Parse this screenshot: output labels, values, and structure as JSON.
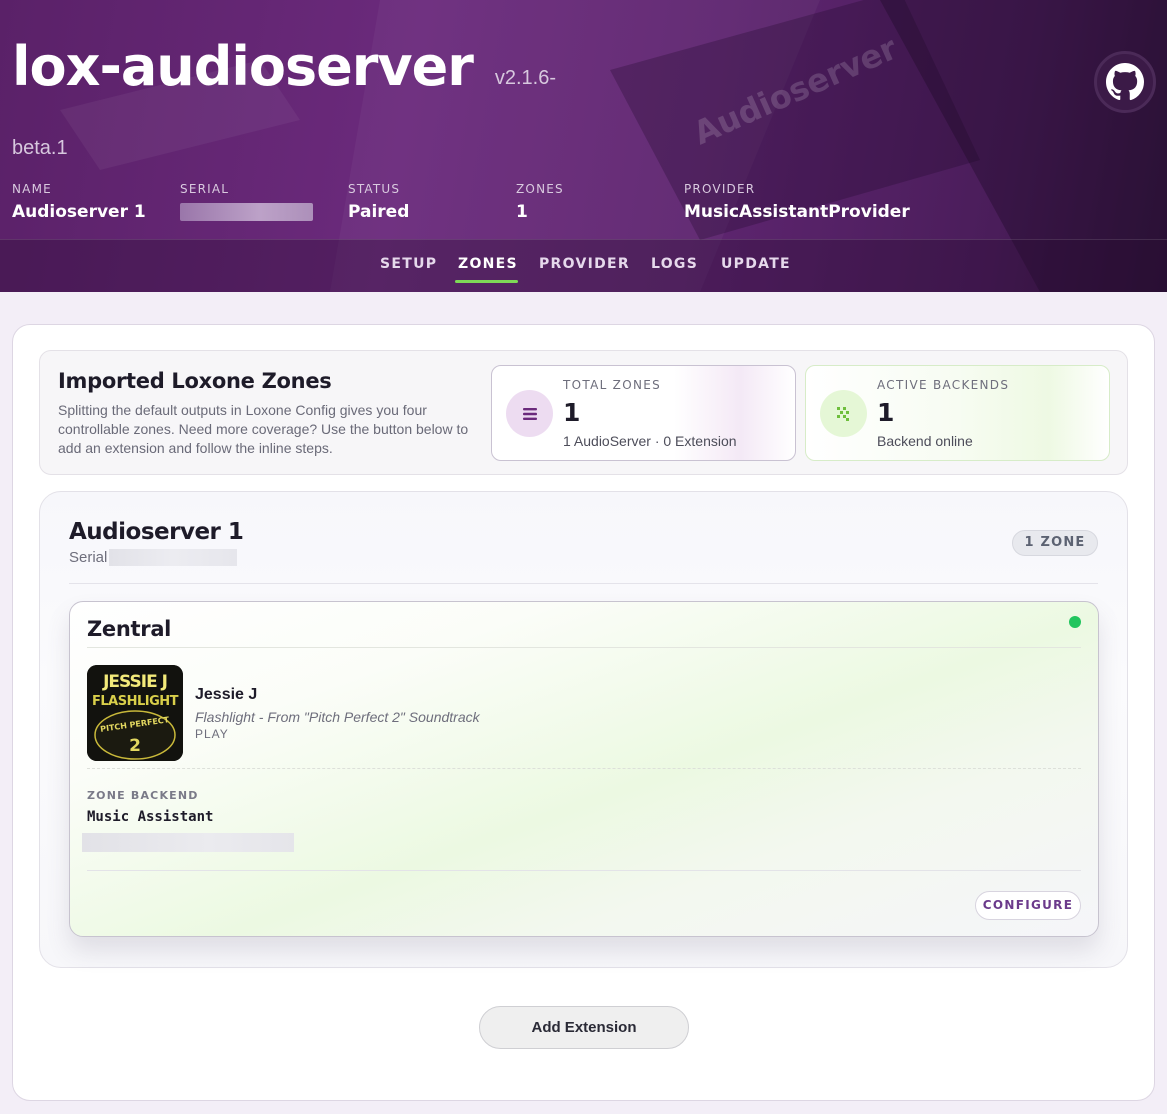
{
  "app": {
    "title": "lox-audioserver",
    "version_line1": "v2.1.6-",
    "version_line2": "beta.1"
  },
  "meta": [
    {
      "label": "NAME",
      "value": "Audioserver 1"
    },
    {
      "label": "SERIAL",
      "value": ""
    },
    {
      "label": "STATUS",
      "value": "Paired"
    },
    {
      "label": "ZONES",
      "value": "1"
    },
    {
      "label": "PROVIDER",
      "value": "MusicAssistantProvider"
    }
  ],
  "nav": {
    "items": [
      "SETUP",
      "ZONES",
      "PROVIDER",
      "LOGS",
      "UPDATE"
    ],
    "active": "ZONES"
  },
  "summary": {
    "title": "Imported Loxone Zones",
    "description": "Splitting the default outputs in Loxone Config gives you four controllable zones. Need more coverage? Use the button below to add an extension and follow the inline steps."
  },
  "stats": {
    "total_zones": {
      "label": "TOTAL ZONES",
      "value": "1",
      "sub": "1 AudioServer · 0 Extension"
    },
    "active_backends": {
      "label": "ACTIVE BACKENDS",
      "value": "1",
      "sub": "Backend online"
    }
  },
  "server": {
    "name": "Audioserver 1",
    "serial_label": "Serial",
    "zone_count": "1 ZONE"
  },
  "zone": {
    "name": "Zentral",
    "status": "online",
    "cover_art": {
      "line1": "JESSIE J",
      "line2": "FLASHLIGHT",
      "line3": "PITCH PERFECT",
      "line4": "2"
    },
    "artist": "Jessie J",
    "title": "Flashlight - From \"Pitch Perfect 2\" Soundtrack",
    "state": "PLAY",
    "backend_label": "ZONE BACKEND",
    "backend_value": "Music Assistant",
    "configure_label": "CONFIGURE"
  },
  "actions": {
    "add_extension_label": "Add Extension"
  },
  "colors": {
    "brand": "#5e2570",
    "accent_underline": "#7ed957",
    "online": "#22c55e",
    "configure_text": "#6b3a8b"
  },
  "icons": {
    "github": "github-icon",
    "zones": "list-icon",
    "backends": "grid-dots-icon",
    "status": "online-dot-icon"
  }
}
